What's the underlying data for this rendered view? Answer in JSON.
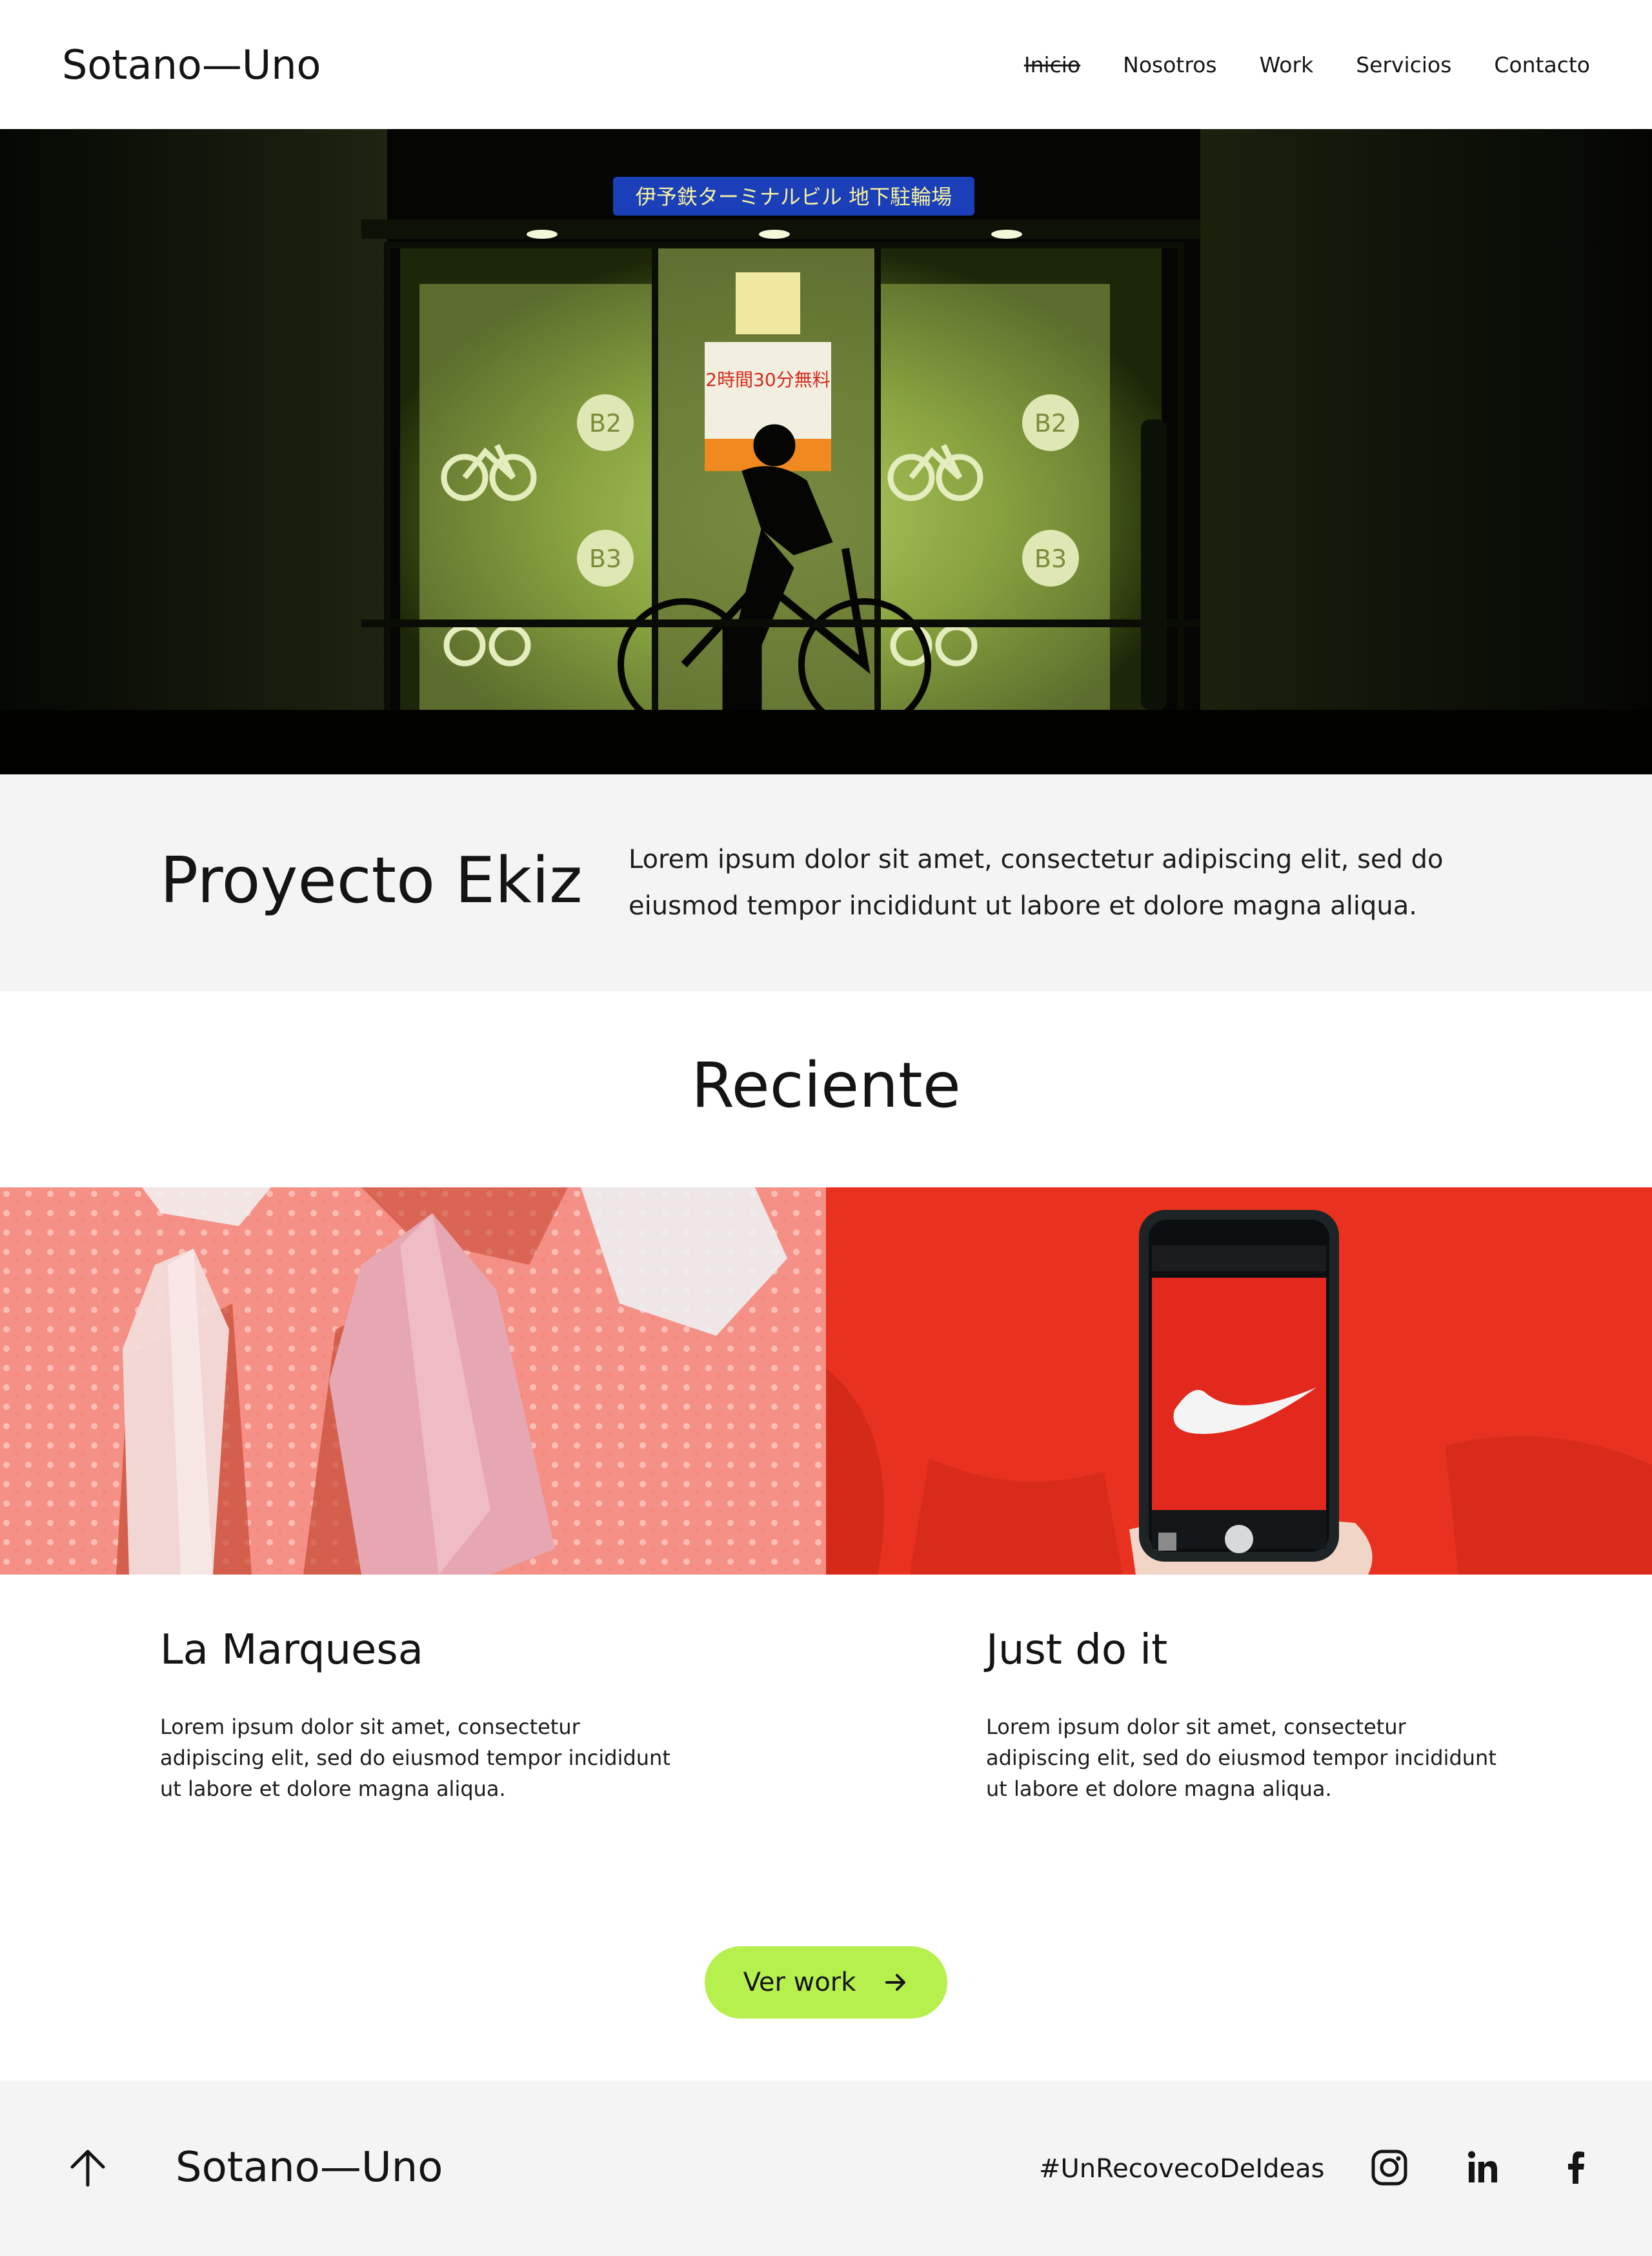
{
  "header": {
    "logo": "Sotano—Uno",
    "nav": [
      {
        "label": "Inicio",
        "active": true
      },
      {
        "label": "Nosotros"
      },
      {
        "label": "Work"
      },
      {
        "label": "Servicios"
      },
      {
        "label": "Contacto"
      }
    ]
  },
  "hero": {
    "image": "night-parking-entrance-cyclist-photo",
    "sign_text": "伊予鉄ターミナルビル 地下駐輪場",
    "floor_badges": [
      "B2",
      "B3"
    ],
    "notice_text": "2時間30分無料"
  },
  "project": {
    "title": "Proyecto Ekiz",
    "description": "Lorem ipsum dolor sit amet, consectetur adipiscing elit, sed do eiusmod tempor incididunt ut labore et dolore magna aliqua."
  },
  "recent": {
    "title": "Reciente",
    "cards": [
      {
        "title": "La Marquesa",
        "description": "Lorem ipsum dolor sit amet, consectetur adipiscing elit, sed do eiusmod tempor incididunt ut labore et dolore magna aliqua.",
        "image": "pink-crystals-photo"
      },
      {
        "title": "Just do it",
        "description": "Lorem ipsum dolor sit amet, consectetur adipiscing elit, sed do eiusmod tempor incididunt ut labore et dolore magna aliqua.",
        "image": "phone-photo-red-sweatshirt"
      }
    ],
    "cta_label": "Ver work"
  },
  "footer": {
    "logo": "Sotano—Uno",
    "hashtag": "#UnRecovecoDeIdeas",
    "social": [
      "instagram-icon",
      "linkedin-icon",
      "facebook-icon"
    ]
  },
  "colors": {
    "accent": "#b6f04d",
    "band_bg": "#f4f4f4",
    "text": "#141414"
  }
}
